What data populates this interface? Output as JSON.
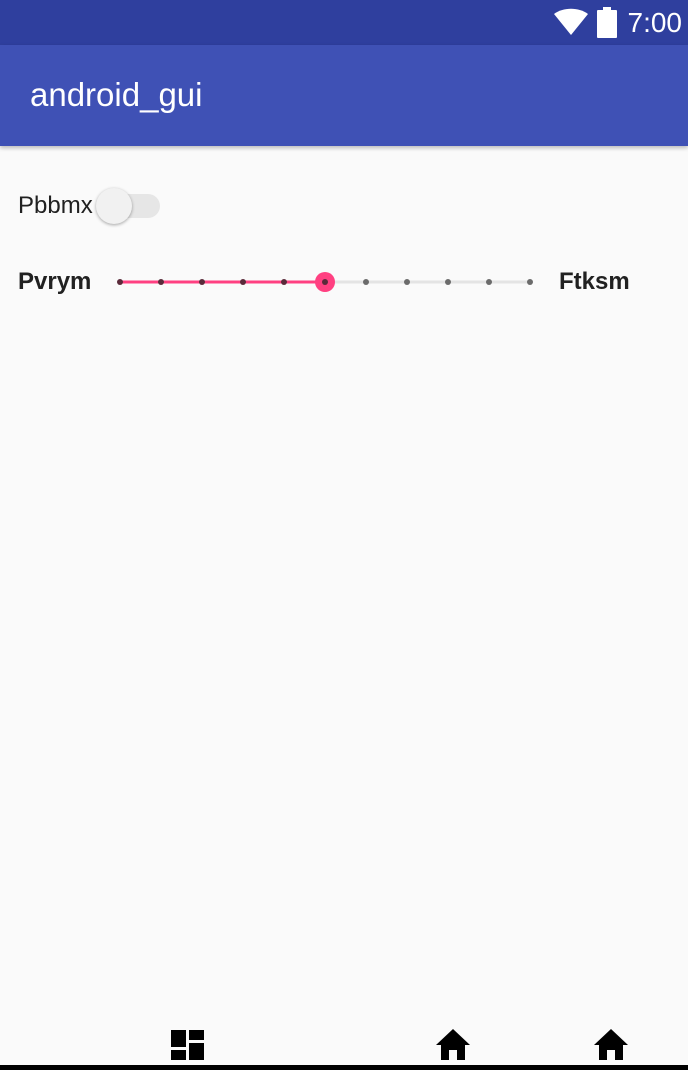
{
  "status_bar": {
    "time": "7:00",
    "icons": [
      "wifi-icon",
      "battery-icon"
    ]
  },
  "app_bar": {
    "title": "android_gui",
    "color": "#3f51b5",
    "status_color": "#2f3f9e"
  },
  "switch": {
    "label": "Pbbmx",
    "checked": false
  },
  "slider": {
    "min_label": "Pvrym",
    "max_label": "Ftksm",
    "steps": 10,
    "value": 5,
    "accent_color": "#ff4081"
  },
  "bottom_nav": {
    "icons": [
      "dashboard-icon",
      "home-icon",
      "home-icon"
    ]
  }
}
